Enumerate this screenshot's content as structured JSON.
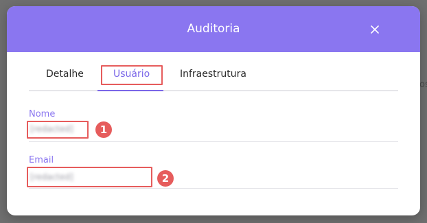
{
  "backdrop": {
    "fragment": "os"
  },
  "modal": {
    "title": "Auditoria",
    "close_icon": "close-icon"
  },
  "tabs": [
    {
      "label": "Detalhe",
      "active": false
    },
    {
      "label": "Usuário",
      "active": true
    },
    {
      "label": "Infraestrutura",
      "active": false
    }
  ],
  "fields": {
    "name": {
      "label": "Nome",
      "value": "[redacted]"
    },
    "email": {
      "label": "Email",
      "value": "[redacted]"
    }
  },
  "annotations": {
    "badge_1": "1",
    "badge_2": "2"
  },
  "colors": {
    "header": "#8a76f0",
    "accent": "#7a66e8",
    "highlight": "#e65c5c"
  }
}
